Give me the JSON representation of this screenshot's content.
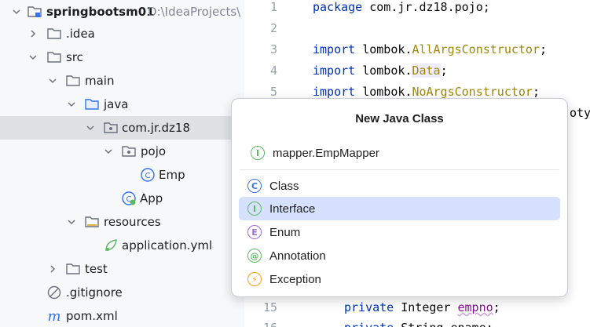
{
  "project_tree": {
    "root": {
      "name": "springbootsm01",
      "path": "D:\\IdeaProjects\\"
    },
    "items": [
      {
        "label": "springbootsm01"
      },
      {
        "label": ".idea"
      },
      {
        "label": "src"
      },
      {
        "label": "main"
      },
      {
        "label": "java"
      },
      {
        "label": "com.jr.dz18"
      },
      {
        "label": "pojo"
      },
      {
        "label": "Emp"
      },
      {
        "label": "App"
      },
      {
        "label": "resources"
      },
      {
        "label": "application.yml"
      },
      {
        "label": "test"
      },
      {
        "label": ".gitignore"
      },
      {
        "label": "pom.xml"
      }
    ]
  },
  "editor": {
    "line_numbers": [
      "1",
      "2",
      "3",
      "4",
      "5",
      "15",
      "16"
    ],
    "lines": {
      "l1_kw": "package",
      "l1_rest": " com.jr.dz18.pojo;",
      "l3_kw": "import",
      "l3_pkg": " lombok.",
      "l3_ann": "AllArgsConstructor",
      "l3_end": ";",
      "l4_kw": "import",
      "l4_pkg": " lombok.",
      "l4_ann": "Data",
      "l4_end": ";",
      "l5_kw": "import",
      "l5_pkg": " lombok.",
      "l5_ann": "NoArgsConstructor",
      "l5_end": ";",
      "l6_frag": "otyp",
      "l15_kw": "private",
      "l15_type": " Integer ",
      "l15_field": "empno",
      "l15_end": ";",
      "l16_kw": "private",
      "l16_rest": " String ename;"
    }
  },
  "popup": {
    "title": "New Java Class",
    "input_value": "mapper.EmpMapper",
    "options": [
      {
        "label": "Class",
        "icon": "class-icon",
        "badge": "C",
        "color": "#3574f0"
      },
      {
        "label": "Interface",
        "icon": "interface-icon",
        "badge": "I",
        "color": "#5fb865",
        "selected": true
      },
      {
        "label": "Enum",
        "icon": "enum-icon",
        "badge": "E",
        "color": "#9f6bd9"
      },
      {
        "label": "Annotation",
        "icon": "annotation-icon",
        "badge": "@",
        "color": "#5fb865"
      },
      {
        "label": "Exception",
        "icon": "exception-icon",
        "badge": "⚡",
        "color": "#f2a317"
      }
    ]
  }
}
